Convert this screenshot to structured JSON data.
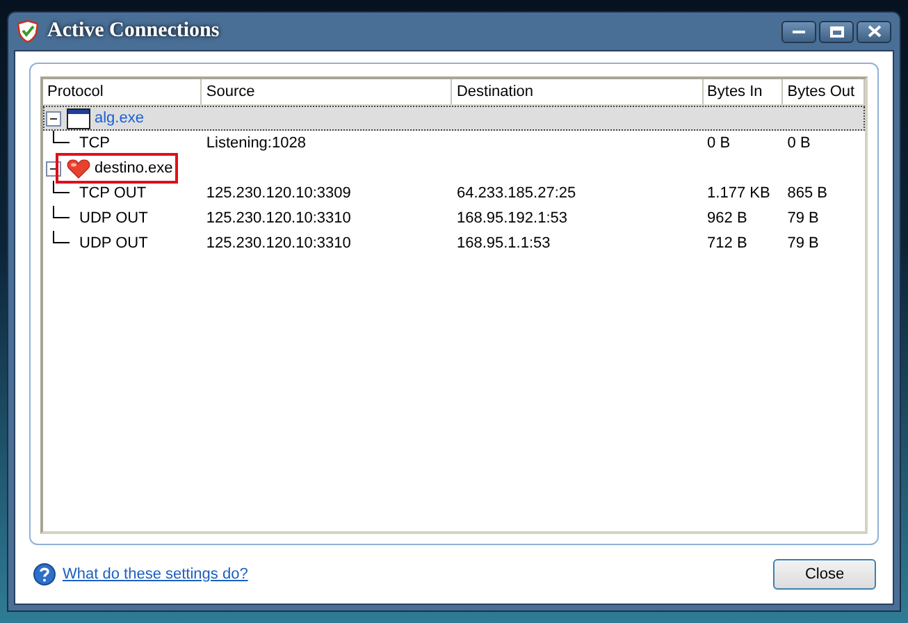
{
  "window": {
    "title": "Active Connections"
  },
  "table": {
    "columns": [
      "Protocol",
      "Source",
      "Destination",
      "Bytes In",
      "Bytes Out"
    ],
    "processes": [
      {
        "name": "alg.exe",
        "kind": "window",
        "selected": true,
        "expanded": true,
        "highlighted": false,
        "connections": [
          {
            "protocol": "TCP",
            "source": "Listening:1028",
            "bytes_in": "0 B",
            "bytes_out": "0 B"
          }
        ]
      },
      {
        "name": "destino.exe",
        "kind": "heart",
        "selected": false,
        "expanded": true,
        "highlighted": true,
        "connections": [
          {
            "protocol": "TCP OUT",
            "source": "125.230.120.10:3309",
            "destination": "64.233.185.27:25",
            "bytes_in": "1.177 KB",
            "bytes_out": "865 B"
          },
          {
            "protocol": "UDP OUT",
            "source": "125.230.120.10:3310",
            "destination": "168.95.192.1:53",
            "bytes_in": "962 B",
            "bytes_out": "79 B"
          },
          {
            "protocol": "UDP OUT",
            "source": "125.230.120.10:3310",
            "destination": "168.95.1.1:53",
            "bytes_in": "712 B",
            "bytes_out": "79 B"
          }
        ]
      }
    ]
  },
  "footer": {
    "help_link": "What do these settings do?",
    "close_button": "Close"
  }
}
